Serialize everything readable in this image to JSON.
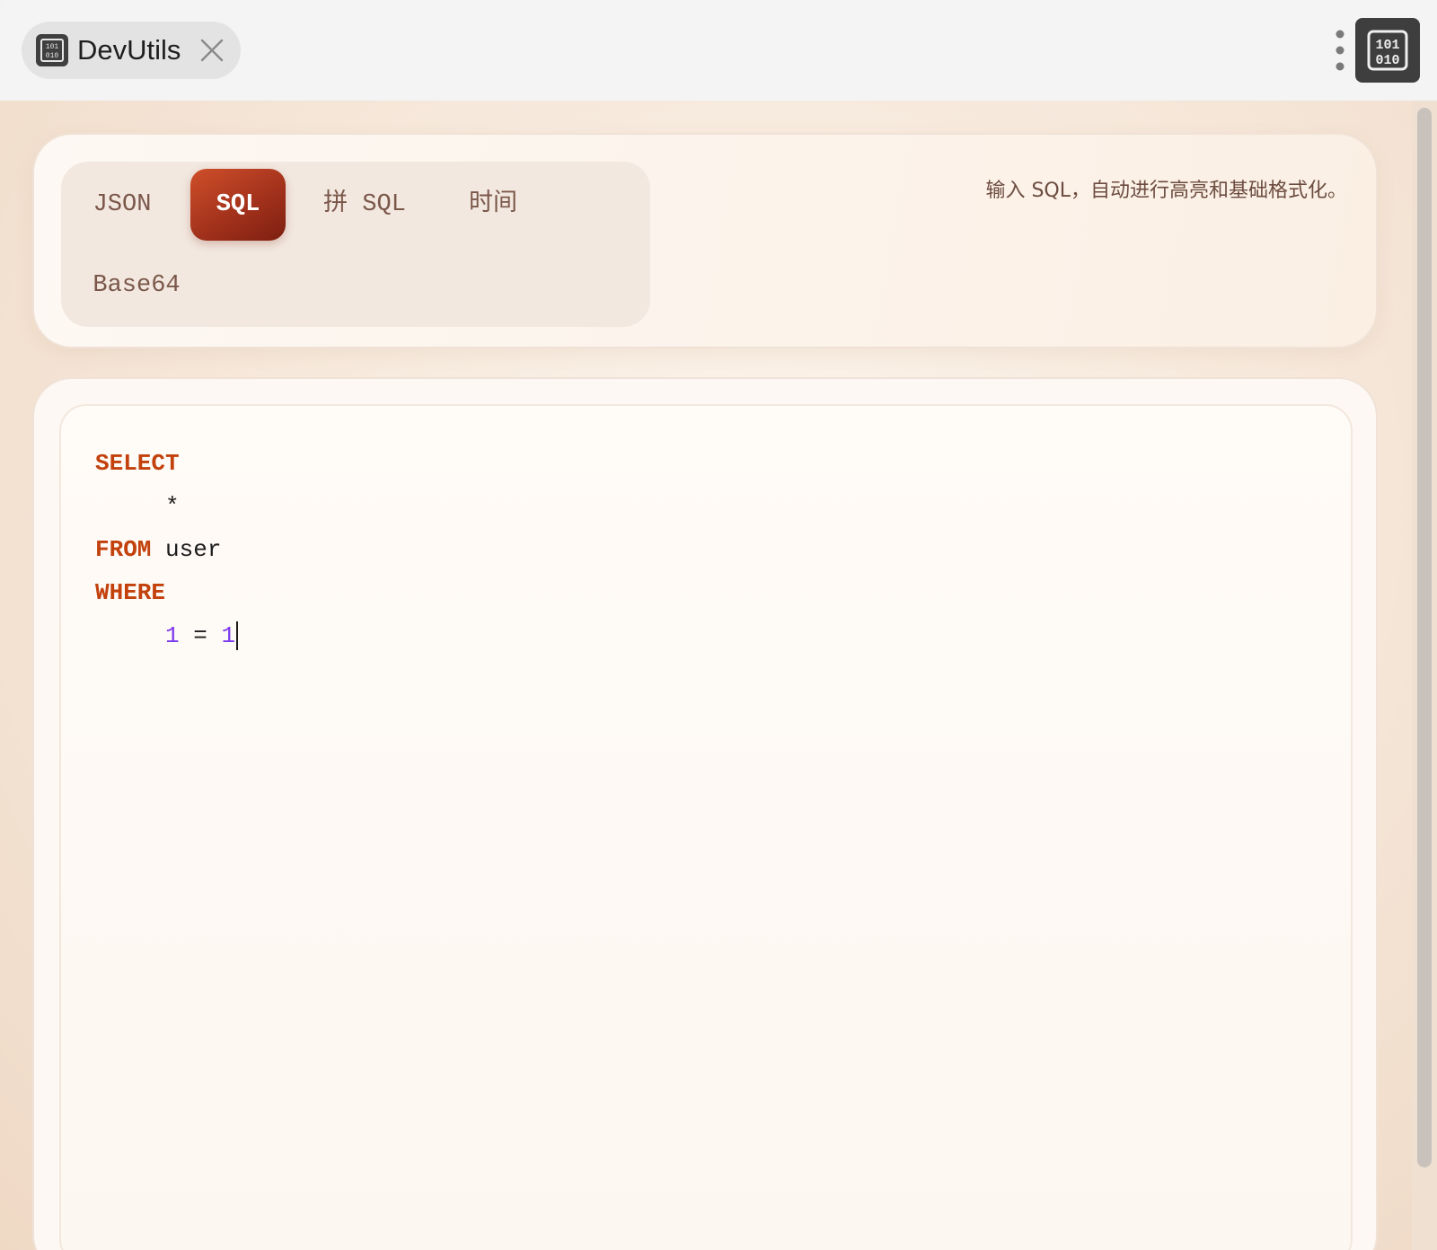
{
  "window": {
    "tab_title": "DevUtils",
    "app_icon": "binary-code-icon",
    "close_icon": "close-icon",
    "menu_icon": "more-vertical-icon",
    "extension_icon": "binary-code-icon"
  },
  "toolbar": {
    "tabs": [
      {
        "label": "JSON",
        "active": false
      },
      {
        "label": "SQL",
        "active": true
      },
      {
        "label": "拼 SQL",
        "active": false
      },
      {
        "label": "时间",
        "active": false
      },
      {
        "label": "Base64",
        "active": false
      }
    ],
    "hint": "输入 SQL，自动进行高亮和基础格式化。"
  },
  "editor": {
    "lines": [
      {
        "kw": "SELECT"
      },
      {
        "text": "*"
      },
      {
        "kw": "FROM",
        "text": "user"
      },
      {
        "kw": "WHERE"
      },
      {
        "num1": "1",
        "op": "=",
        "num2": "1"
      }
    ]
  },
  "colors": {
    "accent": "#b23a1e",
    "keyword": "#c2410c",
    "number": "#7c3aed",
    "tab_text": "#7b574a"
  }
}
